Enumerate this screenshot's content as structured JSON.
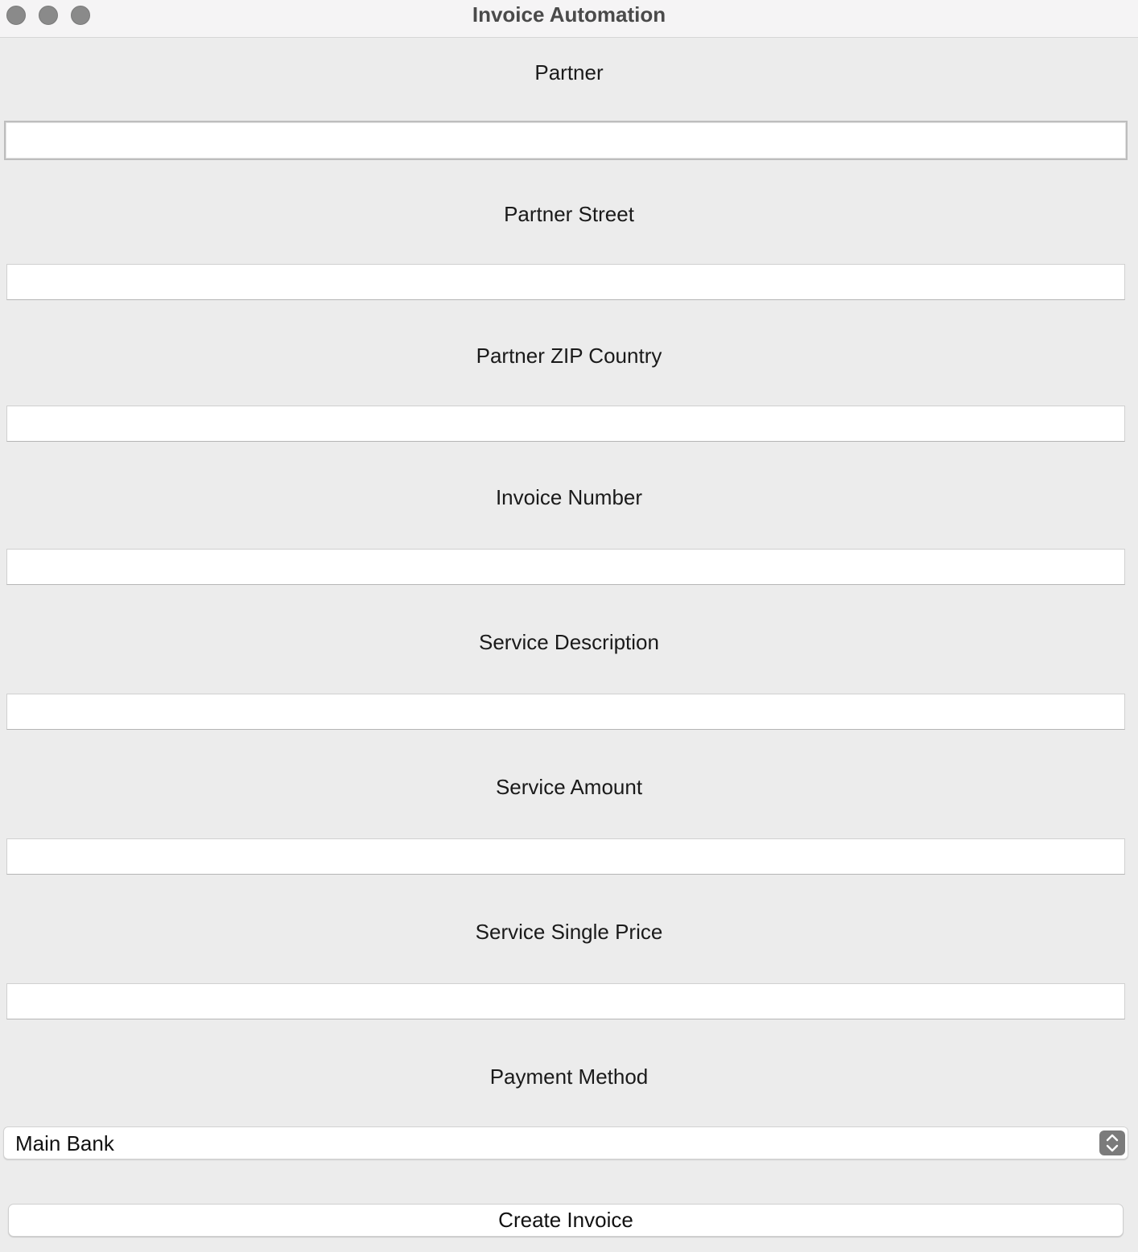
{
  "window": {
    "title": "Invoice Automation"
  },
  "form": {
    "partner": {
      "label": "Partner",
      "value": ""
    },
    "partner_street": {
      "label": "Partner Street",
      "value": ""
    },
    "partner_zip_country": {
      "label": "Partner ZIP Country",
      "value": ""
    },
    "invoice_number": {
      "label": "Invoice Number",
      "value": ""
    },
    "service_description": {
      "label": "Service Description",
      "value": ""
    },
    "service_amount": {
      "label": "Service Amount",
      "value": ""
    },
    "service_single_price": {
      "label": "Service Single Price",
      "value": ""
    },
    "payment_method": {
      "label": "Payment Method",
      "selected": "Main Bank"
    }
  },
  "actions": {
    "create_invoice_label": "Create Invoice"
  },
  "colors": {
    "background": "#ececec",
    "titlebar": "#f5f4f5",
    "traffic_light": "#8a8a8a"
  }
}
